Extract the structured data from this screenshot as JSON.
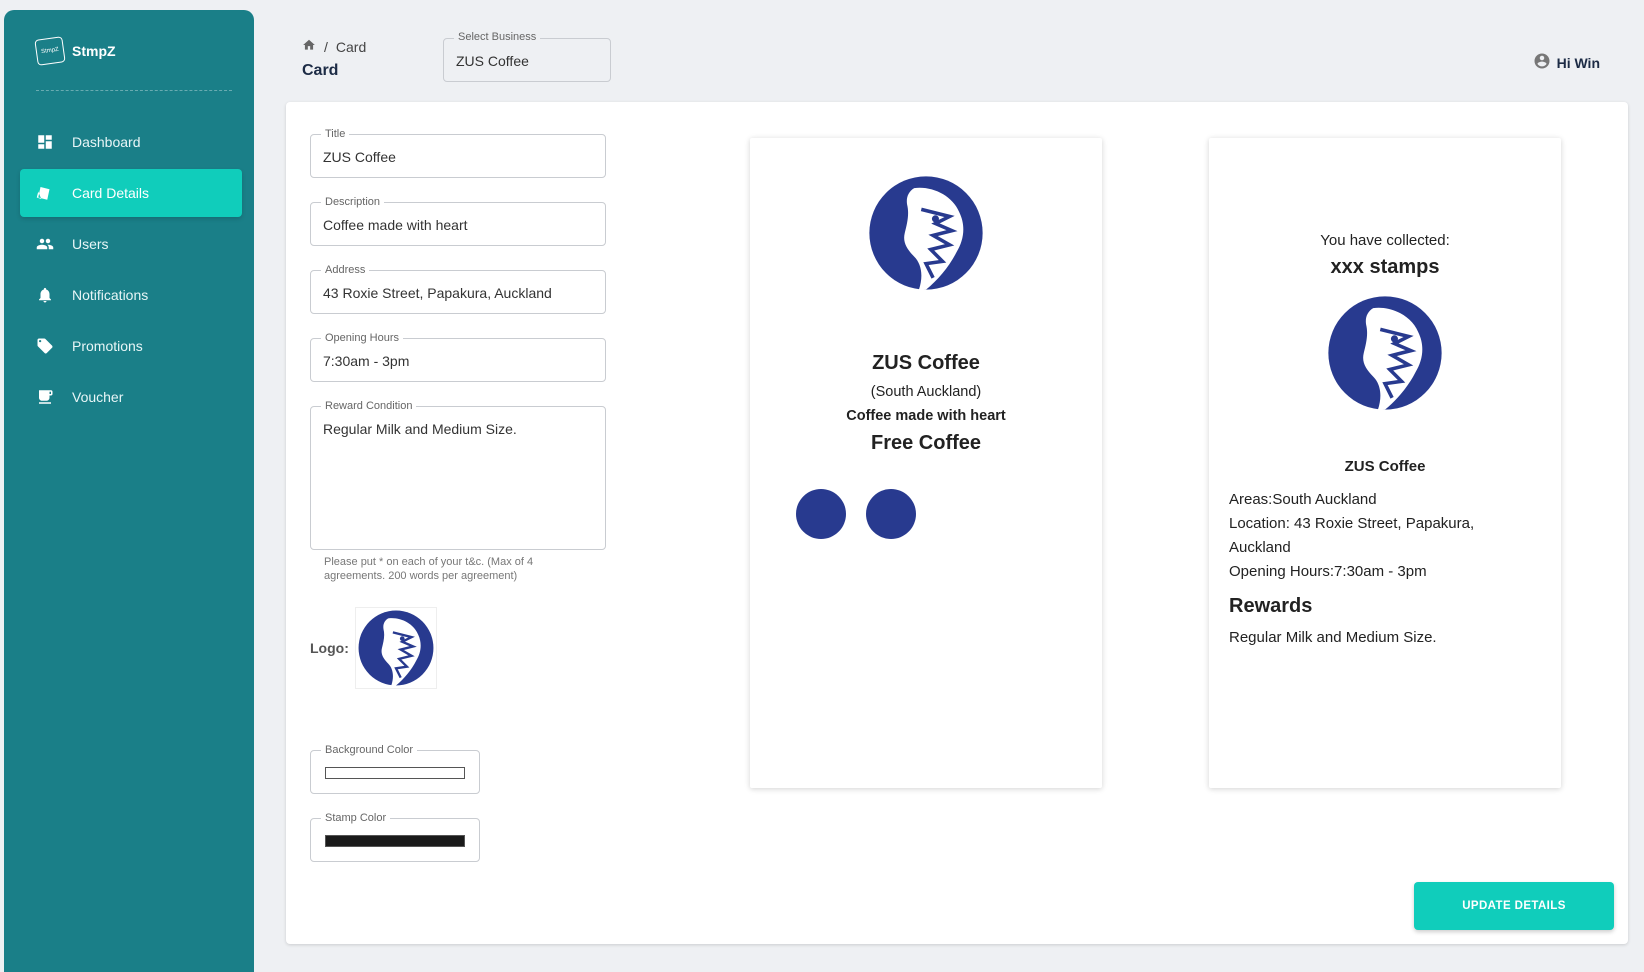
{
  "brand": {
    "name": "StmpZ",
    "logo_text": "StmpZ"
  },
  "sidebar": {
    "items": [
      {
        "label": "Dashboard",
        "icon": "dashboard-icon"
      },
      {
        "label": "Card Details",
        "icon": "card-icon",
        "active": true
      },
      {
        "label": "Users",
        "icon": "users-icon"
      },
      {
        "label": "Notifications",
        "icon": "bell-icon"
      },
      {
        "label": "Promotions",
        "icon": "tag-icon"
      },
      {
        "label": "Voucher",
        "icon": "coffee-cup-icon"
      }
    ]
  },
  "header": {
    "breadcrumb": {
      "home_icon": "home-icon",
      "separator": "/",
      "current": "Card"
    },
    "title": "Card",
    "business_select": {
      "label": "Select Business",
      "value": "ZUS Coffee"
    },
    "user_greeting": "Hi Win"
  },
  "form": {
    "title": {
      "label": "Title",
      "value": "ZUS Coffee"
    },
    "description": {
      "label": "Description",
      "value": "Coffee made with heart"
    },
    "address": {
      "label": "Address",
      "value": "43 Roxie Street, Papakura, Auckland"
    },
    "opening_hours": {
      "label": "Opening Hours",
      "value": "7:30am - 3pm"
    },
    "reward_condition": {
      "label": "Reward Condition",
      "value": "Regular Milk and Medium Size."
    },
    "reward_helper": "Please put * on each of your t&c. (Max of 4 agreements. 200 words per agreement)",
    "logo_label": "Logo:",
    "background_color": {
      "label": "Background Color",
      "value": "#ffffff"
    },
    "stamp_color": {
      "label": "Stamp Color",
      "value": "#1a1a1a"
    }
  },
  "front_card": {
    "name": "ZUS Coffee",
    "area": "(South Auckland)",
    "tagline": "Coffee made with heart",
    "reward": "Free Coffee",
    "stamp_count_shown": 2,
    "stamp_color": "#283a8f"
  },
  "back_card": {
    "collected_label": "You have collected:",
    "collected_value": "xxx stamps",
    "name": "ZUS Coffee",
    "areas": "Areas:South Auckland",
    "location": "Location: 43 Roxie Street, Papakura, Auckland",
    "opening_hours": "Opening Hours:7:30am - 3pm",
    "rewards_heading": "Rewards",
    "rewards_text": "Regular Milk and Medium Size."
  },
  "actions": {
    "update_label": "UPDATE DETAILS"
  },
  "colors": {
    "sidebar": "#1a7f88",
    "accent": "#10cdbb",
    "logo": "#283a8f"
  }
}
